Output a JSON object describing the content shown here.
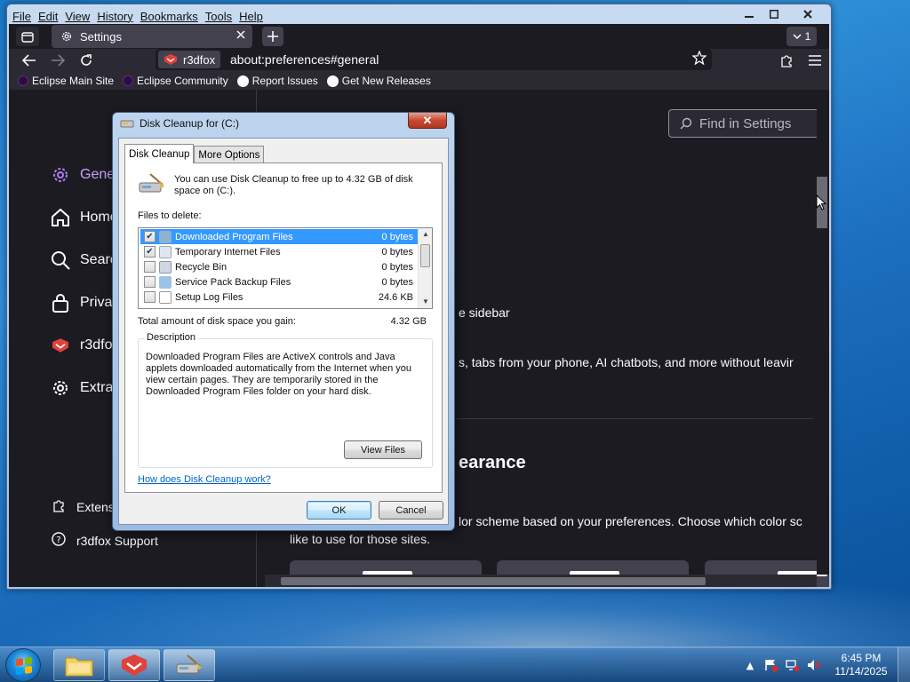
{
  "browser": {
    "menu": [
      "File",
      "Edit",
      "View",
      "History",
      "Bookmarks",
      "Tools",
      "Help"
    ],
    "tab": {
      "title": "Settings"
    },
    "tab_count": "1",
    "identity_label": "r3dfox",
    "url": "about:preferences#general",
    "bookmarks": [
      "Eclipse Main Site",
      "Eclipse Community",
      "Report Issues",
      "Get New Releases"
    ]
  },
  "settings": {
    "search_placeholder": "Find in Settings",
    "sidebar": [
      {
        "label": "General",
        "icon": "gear-icon"
      },
      {
        "label": "Home",
        "icon": "home-icon"
      },
      {
        "label": "Search",
        "icon": "search-icon"
      },
      {
        "label": "Privacy & Security",
        "icon": "lock-icon"
      },
      {
        "label": "r3dfox",
        "icon": "r3dfox-icon"
      },
      {
        "label": "Extra",
        "icon": "gear-icon"
      }
    ],
    "footer_links": [
      "Extensions & Themes",
      "r3dfox Support"
    ],
    "snippets": {
      "sidebar_text": "e sidebar",
      "sidebar_desc": "s, tabs from your phone, AI chatbots, and more without leavir",
      "appearance_heading": "earance",
      "appearance_desc_1": "lor scheme based on your preferences. Choose which color sc",
      "appearance_desc_2": "like to use for those sites."
    }
  },
  "dialog": {
    "title": "Disk Cleanup for  (C:)",
    "close_label": "✕",
    "tabs": [
      "Disk Cleanup",
      "More Options"
    ],
    "intro": "You can use Disk Cleanup to free up to 4.32 GB of disk space on  (C:).",
    "files_label": "Files to delete:",
    "files": [
      {
        "name": "Downloaded Program Files",
        "size": "0 bytes",
        "checked": true,
        "selected": true
      },
      {
        "name": "Temporary Internet Files",
        "size": "0 bytes",
        "checked": true,
        "selected": false
      },
      {
        "name": "Recycle Bin",
        "size": "0 bytes",
        "checked": false,
        "selected": false
      },
      {
        "name": "Service Pack Backup Files",
        "size": "0 bytes",
        "checked": false,
        "selected": false
      },
      {
        "name": "Setup Log Files",
        "size": "24.6 KB",
        "checked": false,
        "selected": false
      }
    ],
    "total_label": "Total amount of disk space you gain:",
    "total_value": "4.32 GB",
    "description_legend": "Description",
    "description": "Downloaded Program Files are ActiveX controls and Java applets downloaded automatically from the Internet when you view certain pages. They are temporarily stored in the Downloaded Program Files folder on your hard disk.",
    "view_files": "View Files",
    "help_link": "How does Disk Cleanup work?",
    "ok": "OK",
    "cancel": "Cancel"
  },
  "taskbar": {
    "time": "6:45 PM",
    "date": "11/14/2025"
  }
}
